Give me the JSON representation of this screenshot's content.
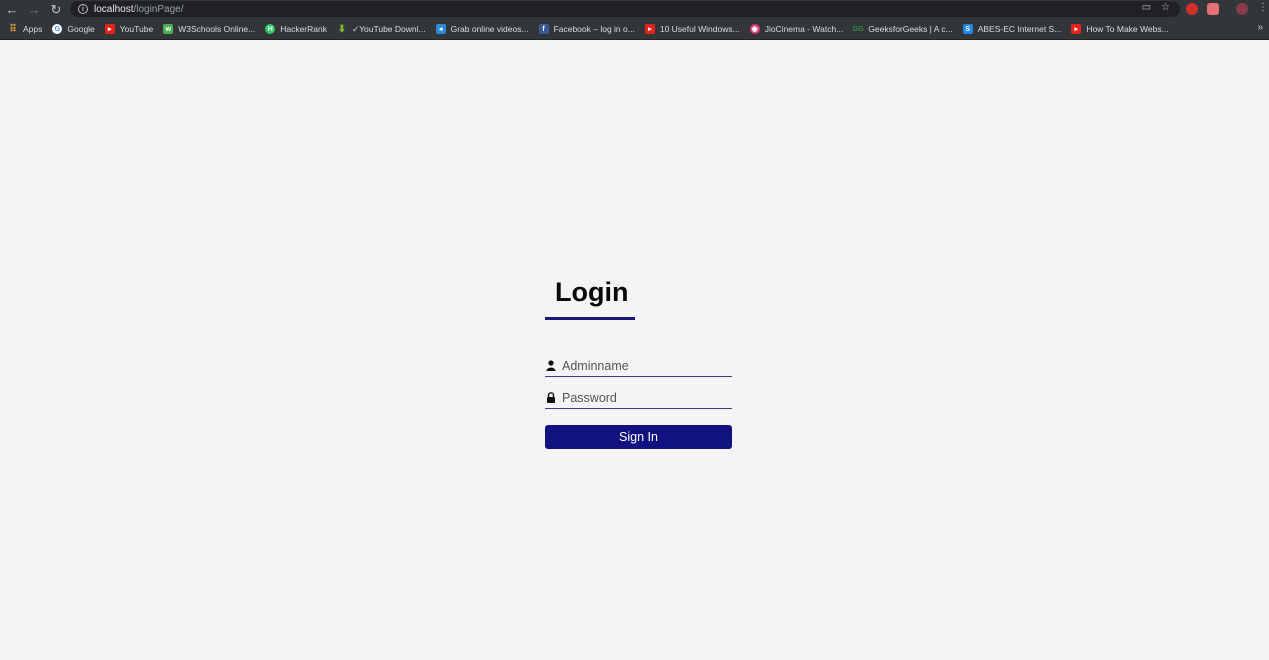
{
  "browser": {
    "url_host": "localhost",
    "url_path": "/loginPage/",
    "bookmarks": [
      {
        "label": "Apps",
        "icon": "apps-grid-icon",
        "color": "#e8a33c"
      },
      {
        "label": "Google",
        "icon": "google-icon",
        "color": "#ffffff"
      },
      {
        "label": "YouTube",
        "icon": "youtube-icon",
        "color": "#e62117"
      },
      {
        "label": "W3Schools Online...",
        "icon": "w3schools-icon",
        "color": "#4caf50"
      },
      {
        "label": "HackerRank",
        "icon": "hackerrank-icon",
        "color": "#2ec866"
      },
      {
        "label": "✓YouTube Downl...",
        "icon": "download-icon",
        "color": "#7cbb2a"
      },
      {
        "label": "Grab online videos...",
        "icon": "video-grab-icon",
        "color": "#2a8bd8"
      },
      {
        "label": "Facebook – log in o...",
        "icon": "facebook-icon",
        "color": "#3b5998"
      },
      {
        "label": "10 Useful Windows...",
        "icon": "youtube-icon",
        "color": "#e62117"
      },
      {
        "label": "JioCinema - Watch...",
        "icon": "jiocinema-icon",
        "color": "#d9407a"
      },
      {
        "label": "GeeksforGeeks | A c...",
        "icon": "geeksforgeeks-icon",
        "color": "#2f8d46"
      },
      {
        "label": "ABES-EC Internet S...",
        "icon": "abes-icon",
        "color": "#1e88e5"
      },
      {
        "label": "How To Make Webs...",
        "icon": "youtube-icon",
        "color": "#e62117"
      }
    ]
  },
  "login": {
    "title": "Login",
    "username_placeholder": "Adminname",
    "password_placeholder": "Password",
    "submit_label": "Sign In",
    "accent_color": "#111180"
  }
}
